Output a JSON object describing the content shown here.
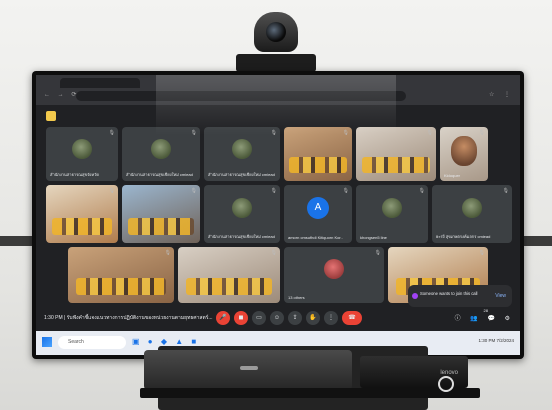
{
  "meet": {
    "tiles": [
      {
        "name": "สำนักงานสาธารณสุขจังหวัด",
        "type": "avatar"
      },
      {
        "name": "สำนักงานสาธารณสุขเชียงใหม่ cmiead",
        "type": "avatar"
      },
      {
        "name": "สำนักงานสาธารณสุขเชียงใหม่ cmiead",
        "type": "avatar"
      },
      {
        "name": "",
        "type": "photo"
      },
      {
        "name": "",
        "type": "photo2"
      },
      {
        "name": "Kidoquer",
        "type": "face"
      },
      {
        "name": "",
        "type": "photo3"
      },
      {
        "name": "",
        "type": "photo4"
      },
      {
        "name": "สำนักงานสาธารณสุขเชียงใหม่ cmiead",
        "type": "avatar"
      },
      {
        "name": "amorn cmsufhdi Kitiquorn Kor..",
        "type": "letter",
        "letter": "A"
      },
      {
        "name": "khongsen5 line",
        "type": "avatar"
      },
      {
        "name": "ยะรงี สุขเกษตรงค์มลกร cmiead",
        "type": "avatar"
      },
      {
        "name": "",
        "type": "photo"
      },
      {
        "name": "",
        "type": "photo2"
      },
      {
        "name": "13 others",
        "type": "others"
      },
      {
        "name": "",
        "type": "photo3"
      }
    ],
    "notification": {
      "text": "Someone wants to join this call",
      "action": "View"
    },
    "bottom": {
      "time": "1:30 PM",
      "meeting_title": "รับฟังคำชี้แจงแนวทางการปฏิบัติงานของหน่วยงานตามยุทธศาสตร์...",
      "participants": "28"
    }
  },
  "taskbar": {
    "search_placeholder": "Search",
    "time": "1:30 PM",
    "date": "7/2/2024"
  }
}
